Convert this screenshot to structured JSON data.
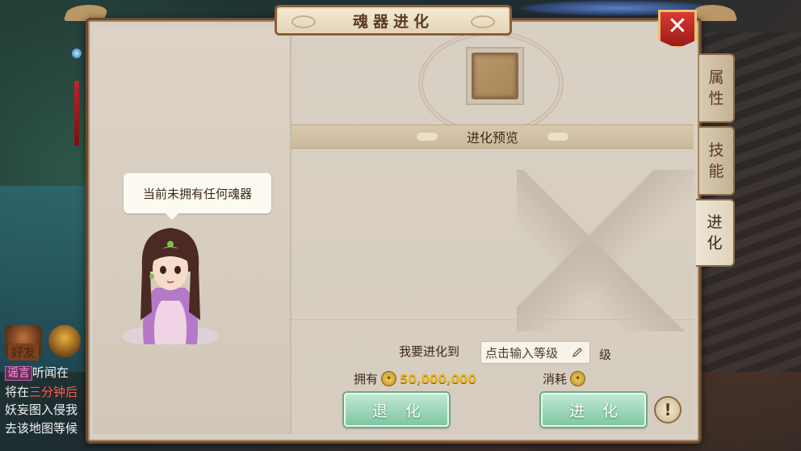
{
  "window": {
    "title": "魂器进化"
  },
  "tabs": [
    {
      "label_top": "属",
      "label_bottom": "性",
      "active": false
    },
    {
      "label_top": "技",
      "label_bottom": "能",
      "active": false
    },
    {
      "label_top": "进",
      "label_bottom": "化",
      "active": true
    }
  ],
  "npc": {
    "message": "当前未拥有任何魂器"
  },
  "preview": {
    "title": "进化预览"
  },
  "evolve_form": {
    "prefix_label": "我要进化到",
    "level_placeholder": "点击输入等级",
    "suffix_label": "级",
    "own_label": "拥有",
    "own_amount": "50,000,000",
    "cost_label": "消耗",
    "cost_amount": ""
  },
  "buttons": {
    "regress": "退化",
    "evolve": "进化",
    "info": "!"
  },
  "side_buttons": {
    "friend": "好友"
  },
  "chat": {
    "lines": [
      {
        "tag": "谣言",
        "text": "听闻在"
      },
      {
        "prefix": "将在",
        "highlight": "三分钟后",
        "text": ""
      },
      {
        "text": "妖妄图入侵我"
      },
      {
        "text": "去该地图等候"
      }
    ]
  },
  "colors": {
    "panel_bg": "#d8d0c4",
    "frame": "#6b4a32",
    "button_green": "#7fc7a3",
    "gold": "#e7b628",
    "close_red": "#d93a30"
  }
}
